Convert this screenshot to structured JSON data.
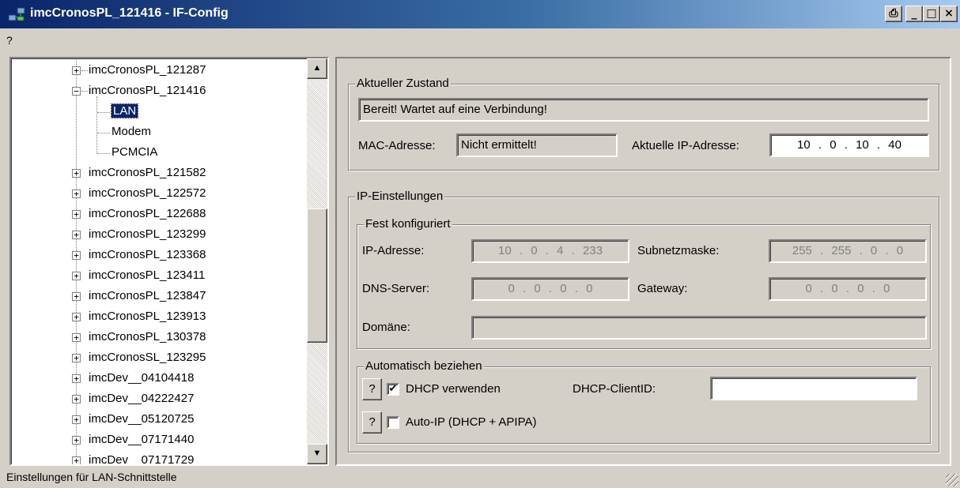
{
  "window": {
    "title": "imcCronosPL_121416 - IF-Config",
    "print_glyph": "⎙",
    "minimize_glyph": "_",
    "maximize_glyph": "□",
    "close_glyph": "×"
  },
  "menu": {
    "help": "?"
  },
  "tree": {
    "expanded_glyph": "−",
    "collapsed_glyph": "+",
    "nodes": [
      "imcCronosPL_121287",
      "imcCronosPL_121416",
      "LAN",
      "Modem",
      "PCMCIA",
      "imcCronosPL_121582",
      "imcCronosPL_122572",
      "imcCronosPL_122688",
      "imcCronosPL_123299",
      "imcCronosPL_123368",
      "imcCronosPL_123411",
      "imcCronosPL_123847",
      "imcCronosPL_123913",
      "imcCronosPL_130378",
      "imcCronosSL_123295",
      "imcDev__04104418",
      "imcDev__04222427",
      "imcDev__05120725",
      "imcDev__07171440",
      "imcDev__07171729"
    ],
    "scroll_up_glyph": "▲",
    "scroll_down_glyph": "▼"
  },
  "status_group": {
    "legend": "Aktueller Zustand",
    "status_value": "Bereit! Wartet auf eine Verbindung!",
    "mac_label": "MAC-Adresse:",
    "mac_value": "Nicht ermittelt!",
    "ip_label": "Aktuelle IP-Adresse:",
    "ip_value": "10 . 0 . 10 . 40"
  },
  "ip_settings": {
    "legend": "IP-Einstellungen",
    "fixed": {
      "legend": "Fest konfiguriert",
      "ip_label": "IP-Adresse:",
      "ip_value": "10 . 0 . 4 . 233",
      "subnet_label": "Subnetzmaske:",
      "subnet_value": "255 . 255 . 0 . 0",
      "dns_label": "DNS-Server:",
      "dns_value": "0 . 0 . 0 . 0",
      "gateway_label": "Gateway:",
      "gateway_value": "0 . 0 . 0 . 0",
      "domain_label": "Domäne:",
      "domain_value": ""
    },
    "auto": {
      "legend": "Automatisch beziehen",
      "help_label": "?",
      "dhcp_label": "DHCP verwenden",
      "dhcp_checked": true,
      "check_glyph": "✔",
      "client_id_label": "DHCP-ClientID:",
      "client_id_value": "",
      "autoip_label": "Auto-IP (DHCP + APIPA)",
      "autoip_checked": false
    }
  },
  "statusbar": {
    "text": "Einstellungen für LAN-Schnittstelle"
  }
}
